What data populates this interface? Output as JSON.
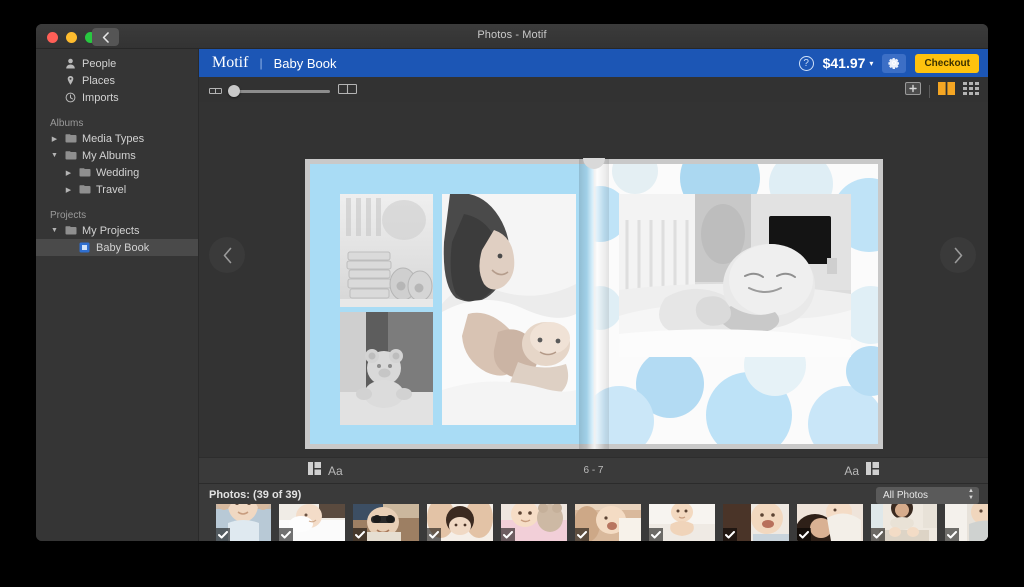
{
  "window": {
    "title": "Photos - Motif",
    "back_label": "back-chevron",
    "traffic_lights": [
      "close",
      "minimize",
      "zoom"
    ]
  },
  "sidebar": {
    "top_items": [
      {
        "label": "People",
        "icon": "person-icon"
      },
      {
        "label": "Places",
        "icon": "pin-icon"
      },
      {
        "label": "Imports",
        "icon": "clock-icon"
      }
    ],
    "groups": [
      {
        "header": "Albums",
        "items": [
          {
            "label": "Media Types",
            "icon": "folder-icon",
            "triangle": "collapsed",
            "indent": 0
          },
          {
            "label": "My Albums",
            "icon": "folder-icon",
            "triangle": "expanded",
            "indent": 0
          },
          {
            "label": "Wedding",
            "icon": "folder-icon",
            "triangle": "collapsed",
            "indent": 1
          },
          {
            "label": "Travel",
            "icon": "folder-icon",
            "triangle": "collapsed",
            "indent": 1
          }
        ]
      },
      {
        "header": "Projects",
        "items": [
          {
            "label": "My Projects",
            "icon": "folder-icon",
            "triangle": "expanded",
            "indent": 0
          },
          {
            "label": "Baby Book",
            "icon": "book-project-icon",
            "triangle": "none",
            "indent": 1,
            "selected": true
          }
        ]
      }
    ]
  },
  "motif_bar": {
    "brand": "Motif",
    "separator": "|",
    "document_name": "Baby Book",
    "help_label": "?",
    "price": "$41.97",
    "price_chevron": "▾",
    "settings_icon": "gear-icon",
    "checkout_label": "Checkout",
    "colors": {
      "bar": "#1c56b5",
      "checkout": "#ffc20e"
    }
  },
  "toolbar": {
    "zoom_out_icon": "single-spread-icon",
    "zoom_in_icon": "double-spread-icon",
    "zoom_value": 8,
    "view_modes": [
      {
        "name": "add-page-icon",
        "selected": false
      },
      {
        "name": "spread-view-icon",
        "selected": true
      },
      {
        "name": "grid-view-icon",
        "selected": false
      }
    ]
  },
  "canvas": {
    "prev_label": "‹",
    "next_label": "›",
    "page_range": "6 - 7",
    "left_tools": [
      {
        "name": "layout-icon",
        "label": ""
      },
      {
        "name": "text-style-icon",
        "label": "Aa"
      }
    ],
    "right_tools": [
      {
        "name": "text-style-icon",
        "label": "Aa"
      },
      {
        "name": "layout-icon",
        "label": ""
      }
    ]
  },
  "photos_panel": {
    "title": "Photos: (39 of 39)",
    "filter_value": "All Photos",
    "thumbnails": [
      {
        "name": "baby-bath-photo",
        "selected": true,
        "w": 55,
        "h": 62,
        "checked": true
      },
      {
        "name": "baby-sleeping-blanket-photo",
        "selected": false,
        "w": 66,
        "h": 47,
        "checked": true
      },
      {
        "name": "baby-glasses-photo",
        "selected": false,
        "w": 66,
        "h": 47,
        "checked": true
      },
      {
        "name": "baby-hands-photo",
        "selected": false,
        "w": 66,
        "h": 47,
        "checked": true
      },
      {
        "name": "baby-teddy-photo",
        "selected": false,
        "w": 66,
        "h": 47,
        "checked": true
      },
      {
        "name": "baby-yawn-photo",
        "selected": false,
        "w": 66,
        "h": 47,
        "checked": true
      },
      {
        "name": "baby-sitting-photo",
        "selected": false,
        "w": 66,
        "h": 47,
        "checked": true
      },
      {
        "name": "baby-laughing-photo",
        "selected": false,
        "w": 66,
        "h": 47,
        "checked": true
      },
      {
        "name": "mother-baby-photo",
        "selected": false,
        "w": 66,
        "h": 47,
        "checked": true
      },
      {
        "name": "mother-twins-photo",
        "selected": false,
        "w": 66,
        "h": 47,
        "checked": true
      },
      {
        "name": "baby-shoulder-photo",
        "selected": false,
        "w": 66,
        "h": 47,
        "checked": true
      }
    ]
  },
  "book": {
    "left_page": {
      "background_color": "#a9dcf5",
      "photos": [
        {
          "name": "folded-clothes-booties-photo"
        },
        {
          "name": "teddy-bear-photo"
        },
        {
          "name": "mother-baby-bed-photo"
        }
      ]
    },
    "right_page": {
      "background_color": "#fbfbfb",
      "pattern": "blue-polka-dots",
      "photos": [
        {
          "name": "baby-tummy-time-photo"
        }
      ]
    }
  }
}
